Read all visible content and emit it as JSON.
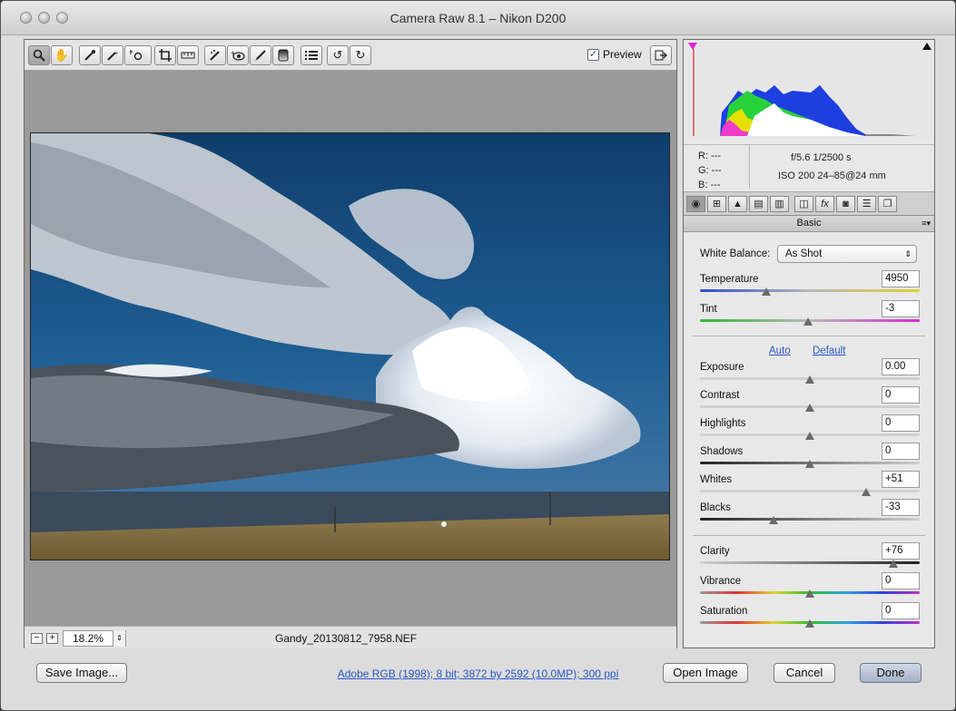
{
  "window": {
    "title": "Camera Raw 8.1  –  Nikon D200"
  },
  "toolbar": {
    "tools": [
      "zoom-tool-icon",
      "hand-tool-icon",
      "white-balance-tool-icon",
      "color-sampler-tool-icon",
      "targeted-adjustment-tool-icon",
      "crop-tool-icon",
      "straighten-tool-icon",
      "spot-removal-tool-icon",
      "red-eye-tool-icon",
      "adjustment-brush-icon",
      "graduated-filter-icon",
      "preferences-list-icon",
      "rotate-ccw-icon",
      "rotate-cw-icon"
    ],
    "preview_label": "Preview",
    "preview_checked": true
  },
  "status": {
    "zoom": "18.2%",
    "filename": "Gandy_20130812_7958.NEF"
  },
  "info": {
    "r": "R:  ---",
    "g": "G:  ---",
    "b": "B:  ---",
    "aperture_shutter": "f/5.6   1/2500 s",
    "iso_lens": "ISO 200   24–85@24 mm"
  },
  "panel": {
    "title": "Basic",
    "white_balance_label": "White Balance:",
    "white_balance_value": "As Shot",
    "auto_link": "Auto",
    "default_link": "Default",
    "controls": [
      {
        "label": "Temperature",
        "value": "4950",
        "level": 0.3
      },
      {
        "label": "Tint",
        "value": "-3",
        "level": 0.49
      },
      {
        "label": "Exposure",
        "value": "0.00",
        "level": 0.5
      },
      {
        "label": "Contrast",
        "value": "0",
        "level": 0.5
      },
      {
        "label": "Highlights",
        "value": "0",
        "level": 0.5
      },
      {
        "label": "Shadows",
        "value": "0",
        "level": 0.5
      },
      {
        "label": "Whites",
        "value": "+51",
        "level": 0.755
      },
      {
        "label": "Blacks",
        "value": "-33",
        "level": 0.335
      },
      {
        "label": "Clarity",
        "value": "+76",
        "level": 0.88
      },
      {
        "label": "Vibrance",
        "value": "0",
        "level": 0.5
      },
      {
        "label": "Saturation",
        "value": "0",
        "level": 0.5
      }
    ]
  },
  "footer": {
    "save_label": "Save Image...",
    "workflow_link": "Adobe RGB (1998); 8 bit; 3872 by 2592 (10.0MP); 300 ppi",
    "open_label": "Open Image",
    "cancel_label": "Cancel",
    "done_label": "Done"
  }
}
